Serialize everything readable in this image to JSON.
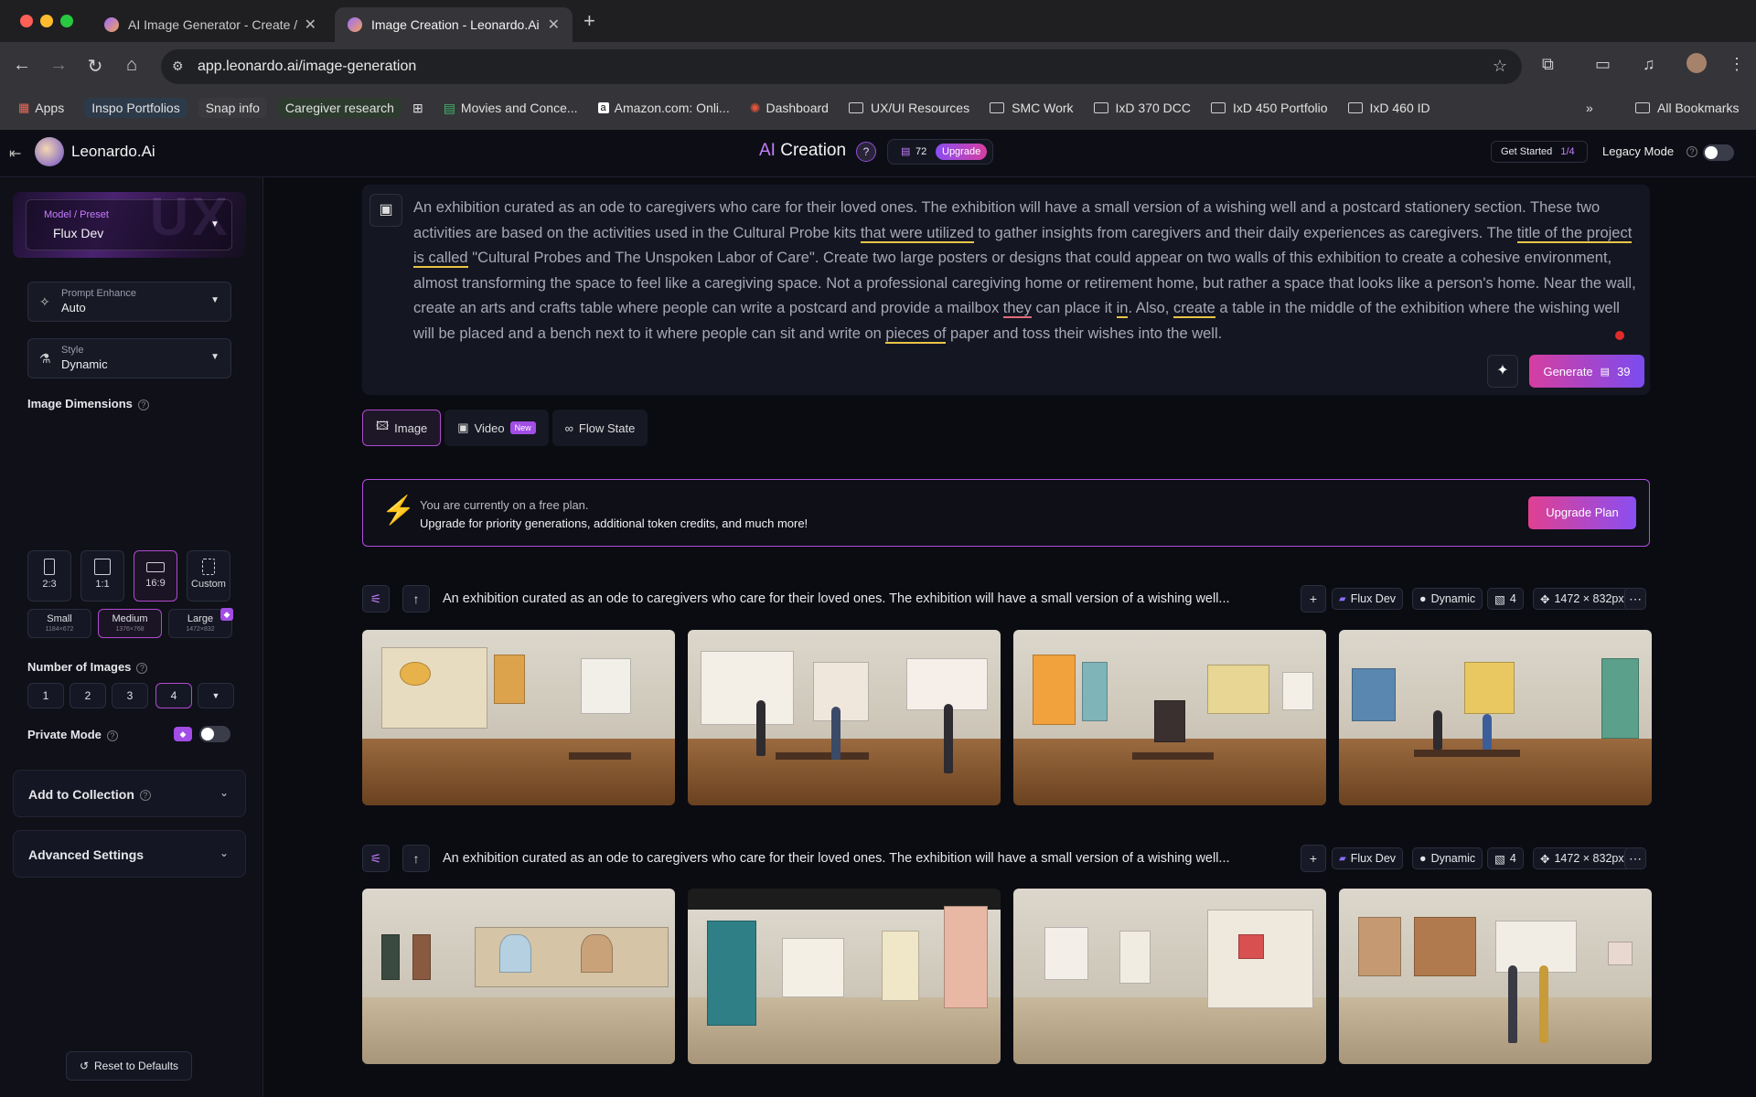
{
  "browser": {
    "tabs": [
      {
        "title": "AI Image Generator - Create /",
        "active": false
      },
      {
        "title": "Image Creation - Leonardo.Ai",
        "active": true
      }
    ],
    "url": "app.leonardo.ai/image-generation",
    "bookmarks": [
      {
        "label": "Apps",
        "type": "apps"
      },
      {
        "label": "Inspo Portfolios",
        "type": "pill"
      },
      {
        "label": "Snap info",
        "type": "pill"
      },
      {
        "label": "Caregiver research",
        "type": "pill"
      },
      {
        "label": "Movies and Conce...",
        "type": "sheet"
      },
      {
        "label": "Amazon.com: Onli...",
        "type": "amazon"
      },
      {
        "label": "Dashboard",
        "type": "site"
      },
      {
        "label": "UX/UI Resources",
        "type": "folder"
      },
      {
        "label": "SMC Work",
        "type": "folder"
      },
      {
        "label": "IxD 370 DCC",
        "type": "folder"
      },
      {
        "label": "IxD 450 Portfolio",
        "type": "folder"
      },
      {
        "label": "IxD 460 ID",
        "type": "folder"
      }
    ],
    "all_bookmarks": "All Bookmarks"
  },
  "topnav": {
    "logo_text": "Leonardo.Ai",
    "title_ai": "AI",
    "title_rest": " Creation",
    "tokens": "72",
    "upgrade": "Upgrade",
    "get_started": "Get Started",
    "get_started_progress": "1/4",
    "legacy_mode": "Legacy Mode"
  },
  "sidebar": {
    "model_label": "Model / Preset",
    "model_value": "Flux Dev",
    "prompt_enhance_label": "Prompt Enhance",
    "prompt_enhance_value": "Auto",
    "style_label": "Style",
    "style_value": "Dynamic",
    "image_dimensions": "Image Dimensions",
    "ratios": [
      "2:3",
      "1:1",
      "16:9",
      "Custom"
    ],
    "selected_ratio": "16:9",
    "sizes": [
      {
        "name": "Small",
        "res": "1184×672"
      },
      {
        "name": "Medium",
        "res": "1376×768"
      },
      {
        "name": "Large",
        "res": "1472×832"
      }
    ],
    "selected_size": "Medium",
    "number_of_images": "Number of Images",
    "counts": [
      "1",
      "2",
      "3",
      "4"
    ],
    "selected_count": "4",
    "private_mode": "Private Mode",
    "add_to_collection": "Add to Collection",
    "advanced_settings": "Advanced Settings",
    "reset": "Reset to Defaults"
  },
  "prompt": {
    "segments": [
      {
        "t": "An exhibition curated as an ode to caregivers who care for their loved ones. The exhibition will have a small version of a wishing well and a postcard stationery section. These two activities are based on the activities used in the Cultural Probe kits ",
        "u": ""
      },
      {
        "t": "that were utilized",
        "u": "y"
      },
      {
        "t": " to gather insights from caregivers and their daily experiences as caregivers. The ",
        "u": ""
      },
      {
        "t": "title of the project is called",
        "u": "y"
      },
      {
        "t": " \"Cultural Probes and The Unspoken Labor of Care\". Create two large posters or designs that could appear on two walls of this exhibition to create a cohesive environment, almost transforming the space to feel like a caregiving space. Not a professional caregiving home or retirement home, but rather a space that looks like a person's home. Near the wall, create an arts and crafts table where people can write a postcard and provide a mailbox ",
        "u": ""
      },
      {
        "t": "they",
        "u": "r"
      },
      {
        "t": " can place it ",
        "u": ""
      },
      {
        "t": "in",
        "u": "y"
      },
      {
        "t": ". Also, ",
        "u": ""
      },
      {
        "t": "create",
        "u": "y"
      },
      {
        "t": " a table in the middle of the exhibition where the wishing well will be placed and a bench next to it where people can sit and write on ",
        "u": ""
      },
      {
        "t": "pieces of",
        "u": "y"
      },
      {
        "t": " paper and toss their wishes into the well.",
        "u": ""
      }
    ],
    "generate_label": "Generate",
    "generate_cost": "39"
  },
  "modes": {
    "image": "Image",
    "video": "Video",
    "video_badge": "New",
    "flow": "Flow State"
  },
  "banner": {
    "line1": "You are currently on a free plan.",
    "line2": "Upgrade for priority generations, additional token credits, and much more!",
    "button": "Upgrade Plan"
  },
  "generations": [
    {
      "prompt": "An exhibition curated as an ode to caregivers who care for their loved ones. The exhibition will have a small version of a wishing well...",
      "model": "Flux Dev",
      "style": "Dynamic",
      "count": "4",
      "dims": "1472 × 832px"
    },
    {
      "prompt": "An exhibition curated as an ode to caregivers who care for their loved ones. The exhibition will have a small version of a wishing well...",
      "model": "Flux Dev",
      "style": "Dynamic",
      "count": "4",
      "dims": "1472 × 832px"
    }
  ],
  "colors": {
    "accent_purple": "#b14ad1",
    "gradient_pink": "#d63ea0",
    "gradient_violet": "#7b4bf0",
    "bolt_yellow": "#f4c430"
  }
}
